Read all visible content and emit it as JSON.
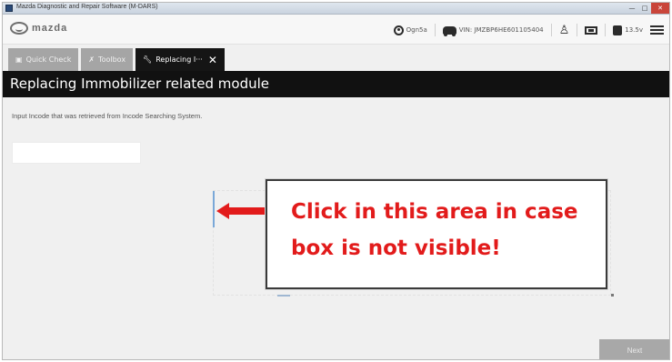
{
  "window": {
    "title": "Mazda Diagnostic and Repair Software (M-DARS)",
    "controls": [
      "—",
      "□",
      "✕"
    ]
  },
  "header": {
    "brand": "mazda",
    "user": "Ogn5a",
    "vin": "VIN: JMZBP6HE601105404",
    "voltage": "13.5v"
  },
  "tabs": [
    {
      "label": "Quick Check",
      "icon": "clipboard-icon",
      "active": false
    },
    {
      "label": "Toolbox",
      "icon": "wrench-cross-icon",
      "active": false
    },
    {
      "label": "Replacing I···",
      "icon": "wrench-icon",
      "active": true,
      "close": "✕"
    }
  ],
  "page": {
    "title": "Replacing Immobilizer related module",
    "instruction": "Input Incode that was retrieved from Incode Searching System.",
    "incode_value": ""
  },
  "callout": {
    "text": "Click in this area in case box is not visible!",
    "color": "#e21b1b"
  },
  "footer": {
    "next_label": "Next"
  }
}
